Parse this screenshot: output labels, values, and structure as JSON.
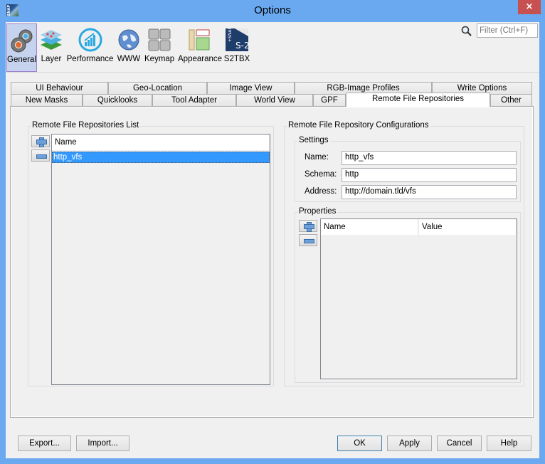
{
  "window": {
    "title": "Options",
    "close_label": "×",
    "app_icon_text": "SNAP"
  },
  "toolbar": {
    "items": [
      {
        "label": "General",
        "icon": "gears-icon",
        "selected": true
      },
      {
        "label": "Layer",
        "icon": "layers-icon"
      },
      {
        "label": "Performance",
        "icon": "performance-chart-icon"
      },
      {
        "label": "WWW",
        "icon": "globe-icon"
      },
      {
        "label": "Keymap",
        "icon": "keyboard-keys-icon"
      },
      {
        "label": "Appearance",
        "icon": "appearance-layout-icon"
      },
      {
        "label": "S2TBX",
        "icon": "snap-s2-icon"
      }
    ],
    "filter_placeholder": "Filter (Ctrl+F)"
  },
  "tabs": {
    "row1": [
      "UI Behaviour",
      "Geo-Location",
      "Image View",
      "RGB-Image Profiles",
      "Write Options"
    ],
    "row2": [
      "New Masks",
      "Quicklooks",
      "Tool Adapter",
      "World View",
      "GPF",
      "Remote File Repositories",
      "Other"
    ],
    "active": "Remote File Repositories"
  },
  "left": {
    "title": "Remote File Repositories List",
    "column": "Name",
    "rows": [
      "http_vfs"
    ],
    "selected": "http_vfs"
  },
  "right": {
    "title": "Remote File Repository Configurations",
    "settings": {
      "title": "Settings",
      "name_label": "Name:",
      "name_value": "http_vfs",
      "schema_label": "Schema:",
      "schema_value": "http",
      "address_label": "Address:",
      "address_value": "http://domain.tld/vfs"
    },
    "properties": {
      "title": "Properties",
      "columns": [
        "Name",
        "Value"
      ]
    }
  },
  "buttons": {
    "export": "Export...",
    "import": "Import...",
    "ok": "OK",
    "apply": "Apply",
    "cancel": "Cancel",
    "help": "Help"
  }
}
